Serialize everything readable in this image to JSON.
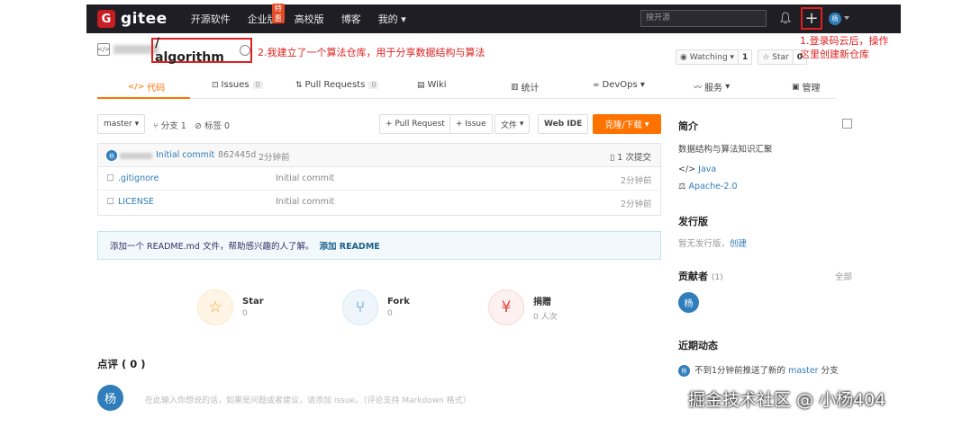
{
  "topnav": {
    "brand": "gitee",
    "links": [
      "开源软件",
      "企业版",
      "高校版",
      "博客",
      "我的"
    ],
    "hot_badge": "特惠",
    "search_placeholder": "搜开源",
    "plus": "+",
    "avatar_initial": "杨"
  },
  "repo": {
    "name": "/ algorithm",
    "watching_label": "Watching",
    "watching_count": "1",
    "star_label": "Star",
    "star_count": "0"
  },
  "annotations": {
    "note_1_line1": "1.登录码云后，操作",
    "note_1_line2": "这里创建新仓库",
    "note_2": "2.我建立了一个算法仓库，用于分享数据结构与算法"
  },
  "tabs": [
    {
      "label": "代码"
    },
    {
      "label": "Issues",
      "count": "0"
    },
    {
      "label": "Pull Requests",
      "count": "0"
    },
    {
      "label": "Wiki"
    },
    {
      "label": "统计"
    },
    {
      "label": "DevOps"
    },
    {
      "label": "服务"
    },
    {
      "label": "管理"
    }
  ],
  "toolbar": {
    "branch": "master",
    "branches": "分支 1",
    "tags": "标签 0",
    "pull_request": "+ Pull Request",
    "issue": "+ Issue",
    "file": "文件",
    "webide": "Web IDE",
    "clone": "克隆/下载"
  },
  "commit": {
    "avatar": "杨",
    "message": "Initial commit",
    "hash": "862445d",
    "time": "2分钟前",
    "count": "1 次提交"
  },
  "files": [
    {
      "name": ".gitignore",
      "message": "Initial commit",
      "time": "2分钟前"
    },
    {
      "name": "LICENSE",
      "message": "Initial commit",
      "time": "2分钟前"
    }
  ],
  "readme": {
    "text": "添加一个 README.md 文件，帮助感兴趣的人了解。",
    "action": "添加 README"
  },
  "stats": [
    {
      "label": "Star",
      "value": "0"
    },
    {
      "label": "Fork",
      "value": "0"
    },
    {
      "label": "捐赠",
      "value": "0 人次"
    }
  ],
  "comments": {
    "title": "点评 ( 0 )",
    "avatar": "杨",
    "placeholder": "在此输入你想说的话，如果是问题或者建议，请添加 issue。（评论支持 Markdown 格式）"
  },
  "sidebar": {
    "intro_title": "简介",
    "intro_text": "数据结构与算法知识汇聚",
    "language": "Java",
    "license": "Apache-2.0",
    "release_title": "发行版",
    "release_text": "暂无发行版，",
    "release_create": "创建",
    "contrib_title": "贡献者",
    "contrib_count": "(1)",
    "contrib_all": "全部",
    "contrib_avatar": "杨",
    "activity_title": "近期动态",
    "activity_avatar": "杨",
    "activity_text": "不到1分钟前推送了新的",
    "activity_branch": "master",
    "activity_suffix": "分支"
  },
  "watermark": "掘金技术社区 @ 小杨404",
  "colors": {
    "accent": "#fe7300",
    "brand": "#c71d23",
    "link": "#2f7dba",
    "annotation": "#e02020"
  }
}
